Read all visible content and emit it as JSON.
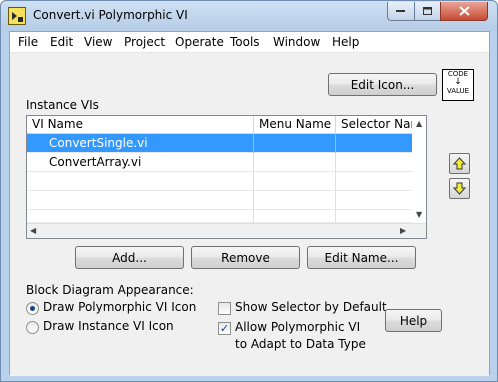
{
  "window": {
    "title": "Convert.vi Polymorphic VI"
  },
  "menubar": {
    "items": [
      "File",
      "Edit",
      "View",
      "Project",
      "Operate",
      "Tools",
      "Window",
      "Help"
    ]
  },
  "edit_icon_button": "Edit Icon...",
  "code_icon": {
    "top": "CODE",
    "bottom": "VALUE"
  },
  "instance_vis": {
    "label": "Instance VIs",
    "columns": [
      "VI Name",
      "Menu Name",
      "Selector Name"
    ],
    "rows": [
      {
        "vi_name": "ConvertSingle.vi",
        "menu_name": "",
        "selector_name": "",
        "selected": true
      },
      {
        "vi_name": "ConvertArray.vi",
        "menu_name": "",
        "selector_name": "",
        "selected": false
      }
    ]
  },
  "buttons": {
    "add": "Add...",
    "remove": "Remove",
    "edit_name": "Edit Name...",
    "help": "Help"
  },
  "block_diagram": {
    "label": "Block Diagram Appearance:",
    "draw_polymorphic": "Draw Polymorphic VI Icon",
    "draw_instance": "Draw Instance VI Icon",
    "draw_polymorphic_selected": true
  },
  "options": {
    "show_selector": "Show Selector by Default",
    "show_selector_checked": false,
    "allow_adapt_line1": "Allow Polymorphic VI",
    "allow_adapt_line2": "to Adapt to Data Type",
    "allow_adapt_checked": true
  },
  "colors": {
    "selection": "#3399ff",
    "frame": "#b9d1ea",
    "close_button": "#c74b32"
  }
}
